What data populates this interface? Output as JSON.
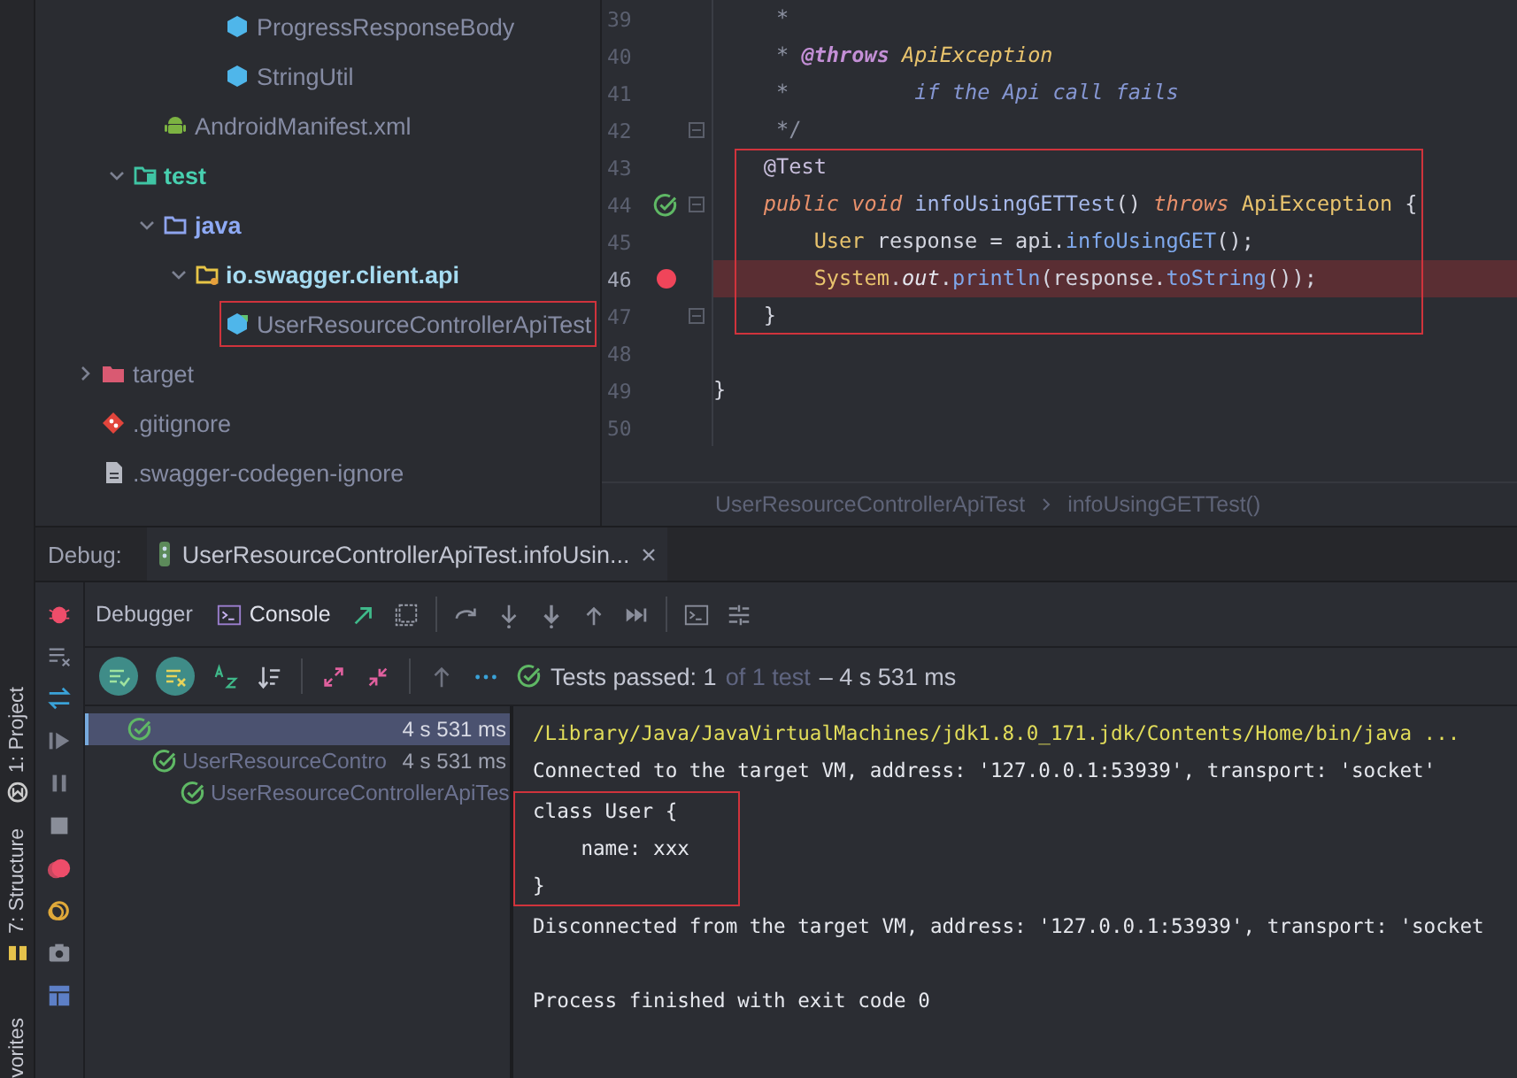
{
  "side_tabs": [
    {
      "label": "1: Project",
      "kind": "project"
    },
    {
      "label": "7: Structure",
      "kind": "structure"
    },
    {
      "label": "vorites",
      "kind": "favorites"
    }
  ],
  "project_tree": [
    {
      "children": [
        {
          "children": [
            {
              "children": [
                {
                  "children": [
                    {
                      "label": "ProgressResponseBody",
                      "kind": "class"
                    },
                    {
                      "label": "StringUtil",
                      "kind": "class"
                    }
                  ]
                }
              ]
            },
            {
              "label": "AndroidManifest.xml",
              "kind": "android"
            }
          ]
        },
        {
          "label": "test",
          "kind": "test_folder",
          "expanded": true,
          "children": [
            {
              "label": "java",
              "kind": "source_folder",
              "expanded": true,
              "children": [
                {
                  "label": "io.swagger.client.api",
                  "kind": "package",
                  "expanded": true,
                  "children": [
                    {
                      "label": "UserResourceControllerApiTest",
                      "kind": "test_class",
                      "outlined": true
                    }
                  ]
                }
              ]
            }
          ]
        }
      ]
    },
    {
      "label": "target",
      "kind": "excluded_folder",
      "expanded": false
    },
    {
      "label": ".gitignore",
      "kind": "git_file"
    },
    {
      "label": ".swagger-codegen-ignore",
      "kind": "text_file"
    }
  ],
  "editor": {
    "blocks": [
      {
        "outlined": false,
        "lines": [
          {
            "number": "39",
            "highlighted": false,
            "breakpoint": false,
            "test_passed": false,
            "fold_marker": false,
            "tokens": [
              {
                "text": "     *",
                "kind": "comment"
              }
            ]
          },
          {
            "number": "40",
            "highlighted": false,
            "breakpoint": false,
            "test_passed": false,
            "fold_marker": false,
            "tokens": [
              {
                "text": "     *",
                "kind": "comment"
              },
              {
                "text": " @throws",
                "kind": "doc_tag"
              },
              {
                "text": " ApiException",
                "kind": "doc_ref"
              }
            ]
          },
          {
            "number": "41",
            "highlighted": false,
            "breakpoint": false,
            "test_passed": false,
            "fold_marker": false,
            "tokens": [
              {
                "text": "     *",
                "kind": "comment"
              },
              {
                "text": "          if the Api call fails",
                "kind": "doc_text"
              }
            ]
          },
          {
            "number": "42",
            "highlighted": false,
            "breakpoint": false,
            "test_passed": false,
            "fold_marker": true,
            "tokens": [
              {
                "text": "     */",
                "kind": "comment"
              }
            ]
          }
        ]
      },
      {
        "outlined": true,
        "lines": [
          {
            "number": "43",
            "highlighted": false,
            "breakpoint": false,
            "test_passed": false,
            "fold_marker": false,
            "tokens": [
              {
                "text": "    @Test",
                "kind": "annotation"
              }
            ]
          },
          {
            "number": "44",
            "highlighted": false,
            "breakpoint": false,
            "test_passed": true,
            "fold_marker": true,
            "tokens": [
              {
                "text": "    public",
                "kind": "keyword"
              },
              {
                "text": " void",
                "kind": "keyword"
              },
              {
                "text": " infoUsingGETTest",
                "kind": "method_decl"
              },
              {
                "text": "()",
                "kind": "plain"
              },
              {
                "text": " throws",
                "kind": "keyword"
              },
              {
                "text": " ApiException",
                "kind": "type"
              },
              {
                "text": " {",
                "kind": "plain"
              }
            ]
          },
          {
            "number": "45",
            "highlighted": false,
            "breakpoint": false,
            "test_passed": false,
            "fold_marker": false,
            "tokens": [
              {
                "text": "        User",
                "kind": "type"
              },
              {
                "text": " response = api.",
                "kind": "plain"
              },
              {
                "text": "infoUsingGET",
                "kind": "method_call"
              },
              {
                "text": "();",
                "kind": "plain"
              }
            ]
          },
          {
            "number": "46",
            "highlighted": true,
            "breakpoint": true,
            "test_passed": false,
            "fold_marker": false,
            "tokens": [
              {
                "text": "        System",
                "kind": "type"
              },
              {
                "text": ".",
                "kind": "plain"
              },
              {
                "text": "out",
                "kind": "static_field"
              },
              {
                "text": ".",
                "kind": "plain"
              },
              {
                "text": "println",
                "kind": "method_call"
              },
              {
                "text": "(response.",
                "kind": "plain"
              },
              {
                "text": "toString",
                "kind": "method_call"
              },
              {
                "text": "());",
                "kind": "plain"
              }
            ]
          },
          {
            "number": "47",
            "highlighted": false,
            "breakpoint": false,
            "test_passed": false,
            "fold_marker": true,
            "tokens": [
              {
                "text": "    }",
                "kind": "plain"
              }
            ]
          }
        ]
      },
      {
        "outlined": false,
        "lines": [
          {
            "number": "48",
            "highlighted": false,
            "breakpoint": false,
            "test_passed": false,
            "fold_marker": false
          },
          {
            "number": "49",
            "highlighted": false,
            "breakpoint": false,
            "test_passed": false,
            "fold_marker": false,
            "tokens": [
              {
                "text": "}",
                "kind": "plain"
              }
            ]
          },
          {
            "number": "50",
            "highlighted": false,
            "breakpoint": false,
            "test_passed": false,
            "fold_marker": false
          }
        ]
      }
    ],
    "breadcrumbs": [
      "UserResourceControllerApiTest",
      "infoUsingGETTest()"
    ]
  },
  "debug": {
    "label": "Debug:",
    "session_tab": "UserResourceControllerApiTest.infoUsin...",
    "tabs": [
      {
        "label": "Debugger",
        "kind": "debugger",
        "selected": false
      },
      {
        "label": "Console",
        "kind": "console",
        "selected": true
      }
    ],
    "tests": {
      "summary": "Tests passed: 1",
      "total": "of 1 test",
      "duration": "– 4 s 531 ms",
      "tree": [
        {
          "passed": true,
          "duration": "4 s 531 ms",
          "selected": true,
          "children": [
            {
              "label": "UserResourceContro",
              "passed": true,
              "duration": "4 s 531 ms",
              "selected": false,
              "children": [
                {
                  "label": "UserResourceControllerApiTes",
                  "passed": true,
                  "selected": false
                }
              ]
            }
          ]
        }
      ]
    },
    "console": {
      "blocks": [
        {
          "outlined": false,
          "lines": [
            {
              "kind": "command",
              "text": "/Library/Java/JavaVirtualMachines/jdk1.8.0_171.jdk/Contents/Home/bin/java ..."
            },
            {
              "kind": "output",
              "text": "Connected to the target VM, address: '127.0.0.1:53939', transport: 'socket'"
            }
          ]
        },
        {
          "outlined": true,
          "lines": [
            {
              "kind": "output",
              "text": "class User {"
            },
            {
              "kind": "output",
              "text": "    name: xxx"
            },
            {
              "kind": "output",
              "text": "}"
            }
          ]
        },
        {
          "outlined": false,
          "lines": [
            {
              "kind": "output",
              "text": "Disconnected from the target VM, address: '127.0.0.1:53939', transport: 'socket"
            },
            {
              "kind": "blank"
            },
            {
              "kind": "output",
              "text": "Process finished with exit code 0"
            }
          ]
        }
      ]
    }
  }
}
